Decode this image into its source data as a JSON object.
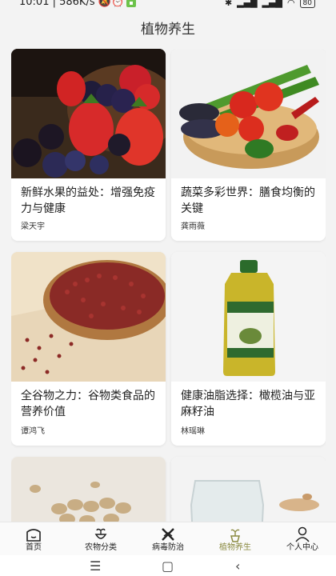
{
  "status": {
    "time_net": "10:01 | 586K/s",
    "battery": "80"
  },
  "page_title": "植物养生",
  "cards": [
    {
      "title": "新鲜水果的益处：增强免疫力与健康",
      "author": "梁天宇",
      "image": "fruits"
    },
    {
      "title": "蔬菜多彩世界：膳食均衡的关键",
      "author": "龚雨薇",
      "image": "vegetables"
    },
    {
      "title": "全谷物之力：谷物类食品的营养价值",
      "author": "谭鸿飞",
      "image": "red-beans"
    },
    {
      "title": "健康油脂选择：橄榄油与亚麻籽油",
      "author": "林瑶琳",
      "image": "olive-oil"
    },
    {
      "title": "",
      "author": "",
      "image": "pistachios"
    },
    {
      "title": "",
      "author": "",
      "image": "glass-jar"
    }
  ],
  "nav": [
    {
      "label": "首页",
      "icon": "home-icon"
    },
    {
      "label": "农物分类",
      "icon": "plant-category-icon"
    },
    {
      "label": "病毒防治",
      "icon": "virus-prevention-icon"
    },
    {
      "label": "植物养生",
      "icon": "plant-wellness-icon",
      "active": true
    },
    {
      "label": "个人中心",
      "icon": "person-icon"
    }
  ],
  "colors": {
    "accent": "#8a8a40",
    "background": "#f3f3f3"
  }
}
